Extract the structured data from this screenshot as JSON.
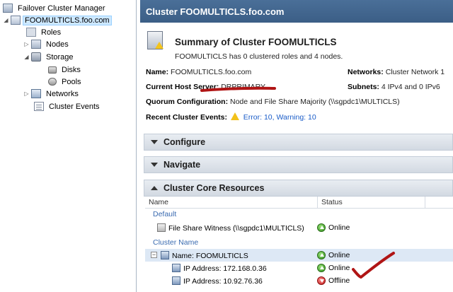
{
  "tree": {
    "root": "Failover Cluster Manager",
    "cluster": "FOOMULTICLS.foo.com",
    "items": [
      {
        "label": "Roles"
      },
      {
        "label": "Nodes"
      },
      {
        "label": "Storage"
      },
      {
        "label": "Disks"
      },
      {
        "label": "Pools"
      },
      {
        "label": "Networks"
      },
      {
        "label": "Cluster Events"
      }
    ]
  },
  "header": {
    "title": "Cluster FOOMULTICLS.foo.com"
  },
  "summary": {
    "title": "Summary of Cluster FOOMULTICLS",
    "subtitle": "FOOMULTICLS has 0 clustered roles and 4 nodes.",
    "name_label": "Name:",
    "name_value": "FOOMULTICLS.foo.com",
    "networks_label": "Networks:",
    "networks_value": "Cluster Network 1",
    "host_label": "Current Host Server:",
    "host_value": "DRPRIMARY",
    "subnets_label": "Subnets:",
    "subnets_value": "4 IPv4 and 0 IPv6",
    "quorum_label": "Quorum Configuration:",
    "quorum_value": "Node and File Share Majority (\\\\sgpdc1\\MULTICLS)",
    "events_label": "Recent Cluster Events:",
    "events_value": "Error: 10, Warning: 10"
  },
  "sections": {
    "configure": "Configure",
    "navigate": "Navigate",
    "core": "Cluster Core Resources"
  },
  "table": {
    "columns": [
      "Name",
      "Status"
    ],
    "groups": [
      {
        "label": "Default",
        "rows": [
          {
            "name": "File Share Witness (\\\\sgpdc1\\MULTICLS)",
            "status": "Online"
          }
        ]
      },
      {
        "label": "Cluster Name",
        "rows": [
          {
            "name": "Name: FOOMULTICLS",
            "status": "Online"
          },
          {
            "name": "IP Address: 172.168.0.36",
            "status": "Online"
          },
          {
            "name": "IP Address: 10.92.76.36",
            "status": "Offline"
          }
        ]
      }
    ]
  },
  "colors": {
    "header_bg": "#3b5e86",
    "link": "#1a5cc8",
    "online": "#2f8f1a",
    "offline": "#c01818",
    "annotation": "#b01515"
  }
}
